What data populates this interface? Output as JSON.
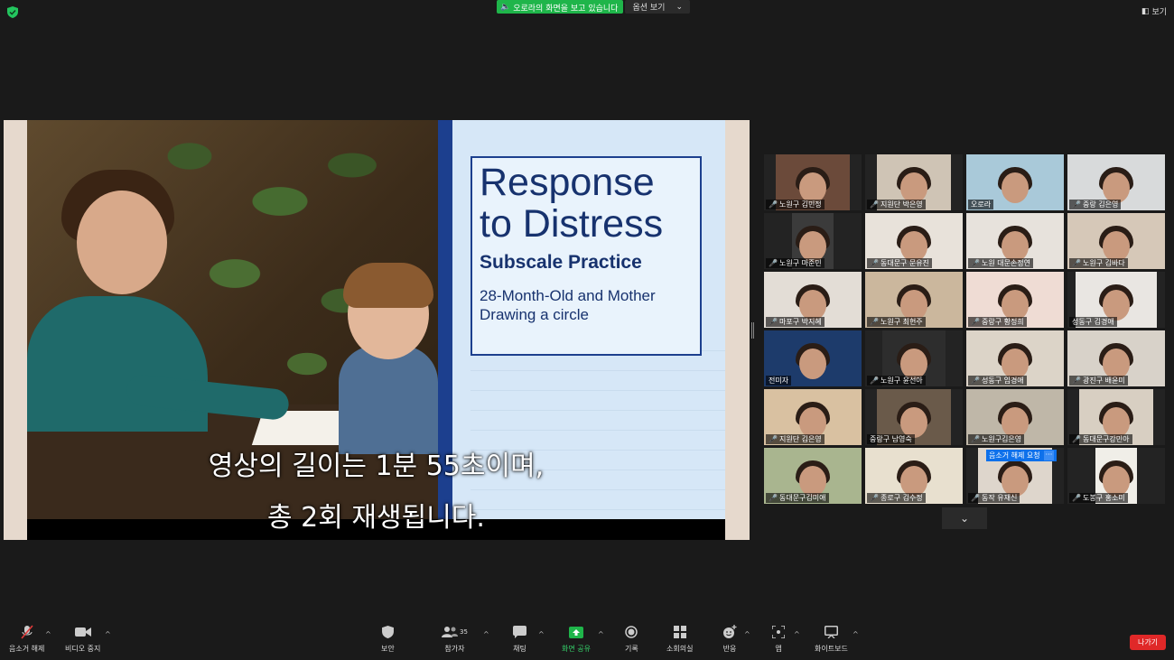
{
  "top": {
    "share_status": "오로라의 화면을 보고 있습니다",
    "view_options": "옵션 보기",
    "view_label": "보기"
  },
  "slide": {
    "title_line1": "Response",
    "title_line2": "to Distress",
    "subtitle": "Subscale Practice",
    "desc_line1": "28-Month-Old and Mother",
    "desc_line2": "Drawing a circle"
  },
  "caption": {
    "line1": "영상의 길이는 1분 55초이며,",
    "line2": "총 2회 재생됩니다."
  },
  "participants": [
    {
      "name": "노원구 김민정",
      "muted": true
    },
    {
      "name": "지원단 박은영",
      "muted": true
    },
    {
      "name": "오로라",
      "muted": false,
      "active": true
    },
    {
      "name": "중랑 김은영",
      "muted": true
    },
    {
      "name": "노원구 마준민",
      "muted": true
    },
    {
      "name": "동대문구 문유진",
      "muted": true
    },
    {
      "name": "노원 대문손정연",
      "muted": true
    },
    {
      "name": "노원구 김바다",
      "muted": true
    },
    {
      "name": "마포구 박지혜",
      "muted": true
    },
    {
      "name": "노원구 최현주",
      "muted": true
    },
    {
      "name": "중랑구 황정희",
      "muted": true
    },
    {
      "name": "성동구 김경애",
      "muted": false
    },
    {
      "name": "전미자",
      "muted": false
    },
    {
      "name": "노원구 윤선아",
      "muted": true
    },
    {
      "name": "성동구 임경애",
      "muted": true
    },
    {
      "name": "광진구 배윤미",
      "muted": true
    },
    {
      "name": "지원단 김은영",
      "muted": true
    },
    {
      "name": "중랑구 남영숙",
      "muted": false
    },
    {
      "name": "노원구김은영",
      "muted": true
    },
    {
      "name": "동대문구강민아",
      "muted": true
    },
    {
      "name": "동대문구김미애",
      "muted": true
    },
    {
      "name": "종로구 김수정",
      "muted": true
    },
    {
      "name": "동작 유재신",
      "muted": true,
      "unmute_request": "음소거 해제 요청"
    },
    {
      "name": "도봉구 홍소미",
      "muted": true
    }
  ],
  "toolbar": {
    "unmute": "음소거 해제",
    "video_stop": "비디오 중지",
    "security": "보안",
    "participants": "참가자",
    "participant_count": "35",
    "chat": "채팅",
    "share": "화면 공유",
    "record": "기록",
    "breakout": "소회의실",
    "reactions": "반응",
    "apps": "앱",
    "whiteboard": "화이트보드",
    "leave": "나가기"
  },
  "colors": {
    "share_green": "#1fb54a",
    "leave_red": "#e02828",
    "active_border": "#d8d84a",
    "unmute_blue": "#0e71eb"
  }
}
